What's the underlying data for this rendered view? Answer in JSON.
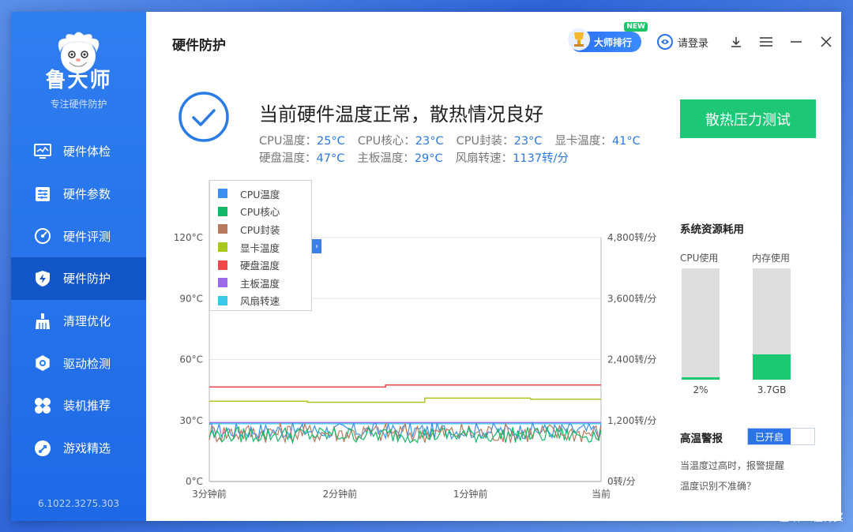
{
  "app": {
    "name": "鲁大师",
    "slogan": "专注硬件防护",
    "version": "6.1022.3275.303"
  },
  "sidebar": {
    "items": [
      {
        "label": "硬件体检",
        "icon": "monitor-icon",
        "active": false
      },
      {
        "label": "硬件参数",
        "icon": "sliders-icon",
        "active": false
      },
      {
        "label": "硬件评测",
        "icon": "gauge-icon",
        "active": false
      },
      {
        "label": "硬件防护",
        "icon": "shield-bolt-icon",
        "active": true
      },
      {
        "label": "清理优化",
        "icon": "broom-icon",
        "active": false
      },
      {
        "label": "驱动检测",
        "icon": "gear-icon",
        "active": false
      },
      {
        "label": "装机推荐",
        "icon": "fan-icon",
        "active": false
      },
      {
        "label": "游戏精选",
        "icon": "rocket-icon",
        "active": false
      }
    ]
  },
  "header": {
    "title": "硬件防护",
    "master_rank": "大师排行",
    "new_badge": "NEW",
    "login": "请登录"
  },
  "status": {
    "title": "当前硬件温度正常，散热情况良好",
    "metrics_row1": [
      {
        "label": "CPU温度：",
        "value": "25°C"
      },
      {
        "label": "CPU核心：",
        "value": "23°C"
      },
      {
        "label": "CPU封装：",
        "value": "23°C"
      },
      {
        "label": "显卡温度：",
        "value": "41°C"
      }
    ],
    "metrics_row2": [
      {
        "label": "硬盘温度：",
        "value": "47°C"
      },
      {
        "label": "主板温度：",
        "value": "29°C"
      },
      {
        "label": "风扇转速：",
        "value": "1137转/分"
      }
    ],
    "stress_button": "散热压力测试"
  },
  "chart_data": {
    "type": "line",
    "y_left_ticks": [
      "120°C",
      "90°C",
      "60°C",
      "30°C",
      "0°C"
    ],
    "y_right_ticks": [
      "4,800转/分",
      "3,600转/分",
      "2,400转/分",
      "1,200转/分",
      "0转/分"
    ],
    "x_ticks": [
      "3分钟前",
      "2分钟前",
      "1分钟前",
      "当前"
    ],
    "ylim_left": [
      0,
      120
    ],
    "ylim_right": [
      0,
      4800
    ],
    "legend": [
      {
        "name": "CPU温度",
        "color": "#3a8ff0"
      },
      {
        "name": "CPU核心",
        "color": "#15b86a"
      },
      {
        "name": "CPU封装",
        "color": "#b87a5e"
      },
      {
        "name": "显卡温度",
        "color": "#a8c820"
      },
      {
        "name": "硬盘温度",
        "color": "#f04848"
      },
      {
        "name": "主板温度",
        "color": "#9a6ae8"
      },
      {
        "name": "风扇转速",
        "color": "#3ac8e8"
      }
    ],
    "series": [
      {
        "name": "硬盘温度",
        "segments": [
          [
            0,
            0.3,
            46.5
          ],
          [
            0.3,
            0.45,
            46.5
          ],
          [
            0.45,
            0.78,
            47.5
          ],
          [
            0.78,
            1.0,
            47.5
          ]
        ]
      },
      {
        "name": "显卡温度",
        "segments": [
          [
            0,
            0.25,
            39.5
          ],
          [
            0.25,
            0.55,
            39
          ],
          [
            0.55,
            0.82,
            41
          ],
          [
            0.82,
            1.0,
            40.5
          ]
        ]
      },
      {
        "name": "主板温度",
        "level": 29
      },
      {
        "name": "风扇转速",
        "level": 1137
      }
    ],
    "noisy_series": [
      {
        "name": "CPU温度",
        "base": 25,
        "amp": 4
      },
      {
        "name": "CPU封装",
        "base": 24,
        "amp": 5
      },
      {
        "name": "CPU核心",
        "base": 23,
        "amp": 4
      }
    ]
  },
  "resources": {
    "title": "系统资源耗用",
    "cpu_label": "CPU使用",
    "mem_label": "内存使用",
    "cpu_value": "2%",
    "mem_value": "3.7GB",
    "cpu_fill": 0.02,
    "mem_fill": 0.23
  },
  "alarm": {
    "title": "高温警报",
    "toggle_on": "已开启",
    "hint1": "当温度过高时，报警提醒",
    "hint2": "温度识别不准确？"
  },
  "watermark": "值 什么值得买"
}
